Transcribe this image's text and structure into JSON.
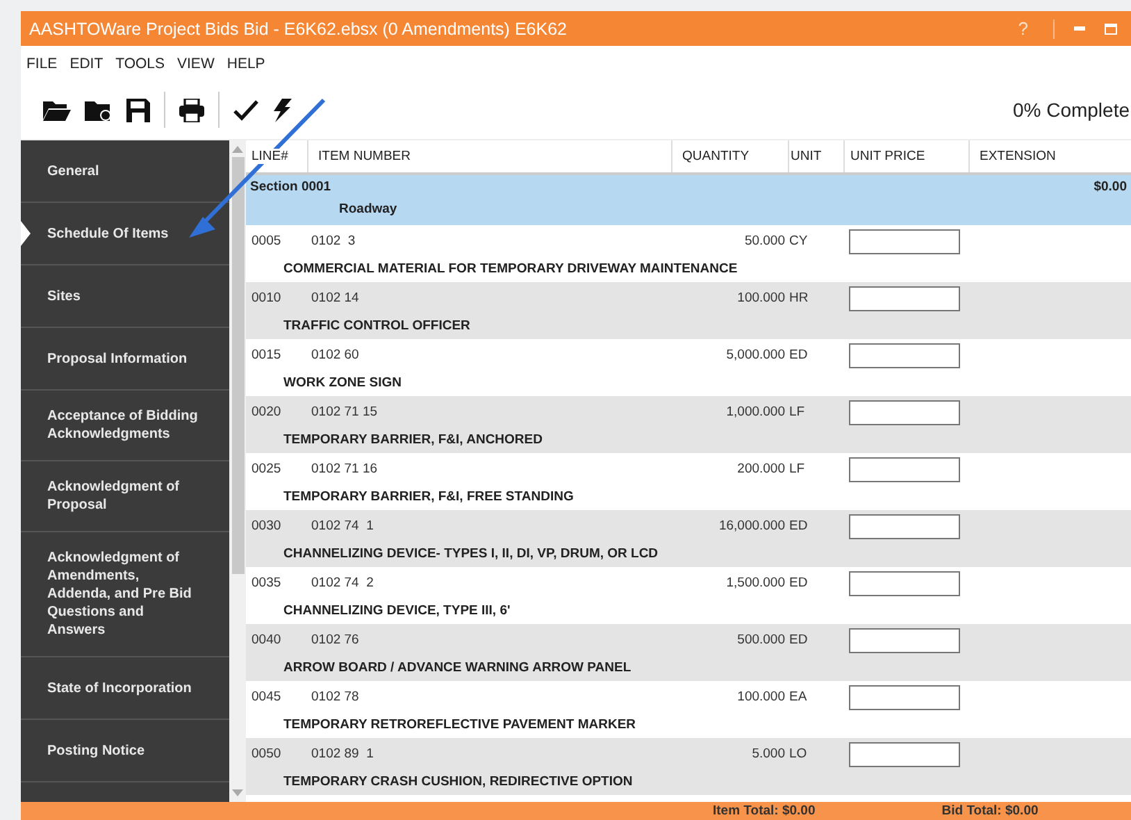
{
  "window": {
    "title": "AASHTOWare Project Bids Bid - E6K62.ebsx (0 Amendments) E6K62",
    "help": "?"
  },
  "menu": [
    "FILE",
    "EDIT",
    "TOOLS",
    "VIEW",
    "HELP"
  ],
  "toolbar": {
    "progress": "0% Complete"
  },
  "sidebar": {
    "items": [
      {
        "label": "General",
        "selected": false
      },
      {
        "label": "Schedule Of Items",
        "selected": true
      },
      {
        "label": "Sites",
        "selected": false
      },
      {
        "label": "Proposal Information",
        "selected": false
      },
      {
        "label": "Acceptance of Bidding Acknowledgments",
        "selected": false
      },
      {
        "label": "Acknowledgment of Proposal",
        "selected": false
      },
      {
        "label": "Acknowledgment of Amendments, Addenda, and Pre Bid Questions and Answers",
        "selected": false
      },
      {
        "label": "State of Incorporation",
        "selected": false
      },
      {
        "label": "Posting Notice",
        "selected": false
      }
    ]
  },
  "table": {
    "columns": [
      "LINE#",
      "ITEM NUMBER",
      "QUANTITY",
      "UNIT",
      "UNIT PRICE",
      "EXTENSION"
    ],
    "section": {
      "name": "Section 0001",
      "description": "Roadway",
      "extension": "$0.00"
    },
    "rows": [
      {
        "line": "0005",
        "item": "0102  3",
        "quantity": "50.000",
        "unit": "CY",
        "description": "COMMERCIAL MATERIAL FOR TEMPORARY DRIVEWAY MAINTENANCE"
      },
      {
        "line": "0010",
        "item": "0102 14",
        "quantity": "100.000",
        "unit": "HR",
        "description": "TRAFFIC CONTROL OFFICER"
      },
      {
        "line": "0015",
        "item": "0102 60",
        "quantity": "5,000.000",
        "unit": "ED",
        "description": "WORK ZONE SIGN"
      },
      {
        "line": "0020",
        "item": "0102 71 15",
        "quantity": "1,000.000",
        "unit": "LF",
        "description": "TEMPORARY BARRIER, F&I, ANCHORED"
      },
      {
        "line": "0025",
        "item": "0102 71 16",
        "quantity": "200.000",
        "unit": "LF",
        "description": "TEMPORARY BARRIER, F&I, FREE STANDING"
      },
      {
        "line": "0030",
        "item": "0102 74  1",
        "quantity": "16,000.000",
        "unit": "ED",
        "description": "CHANNELIZING DEVICE- TYPES I, II, DI, VP, DRUM, OR LCD"
      },
      {
        "line": "0035",
        "item": "0102 74  2",
        "quantity": "1,500.000",
        "unit": "ED",
        "description": "CHANNELIZING DEVICE, TYPE III, 6'"
      },
      {
        "line": "0040",
        "item": "0102 76",
        "quantity": "500.000",
        "unit": "ED",
        "description": "ARROW BOARD / ADVANCE WARNING ARROW PANEL"
      },
      {
        "line": "0045",
        "item": "0102 78",
        "quantity": "100.000",
        "unit": "EA",
        "description": "TEMPORARY RETROREFLECTIVE PAVEMENT MARKER"
      },
      {
        "line": "0050",
        "item": "0102 89  1",
        "quantity": "5.000",
        "unit": "LO",
        "description": "TEMPORARY CRASH CUSHION, REDIRECTIVE OPTION"
      }
    ]
  },
  "status_bar": {
    "item_total": "Item Total: $0.00",
    "bid_total": "Bid Total: $0.00"
  }
}
